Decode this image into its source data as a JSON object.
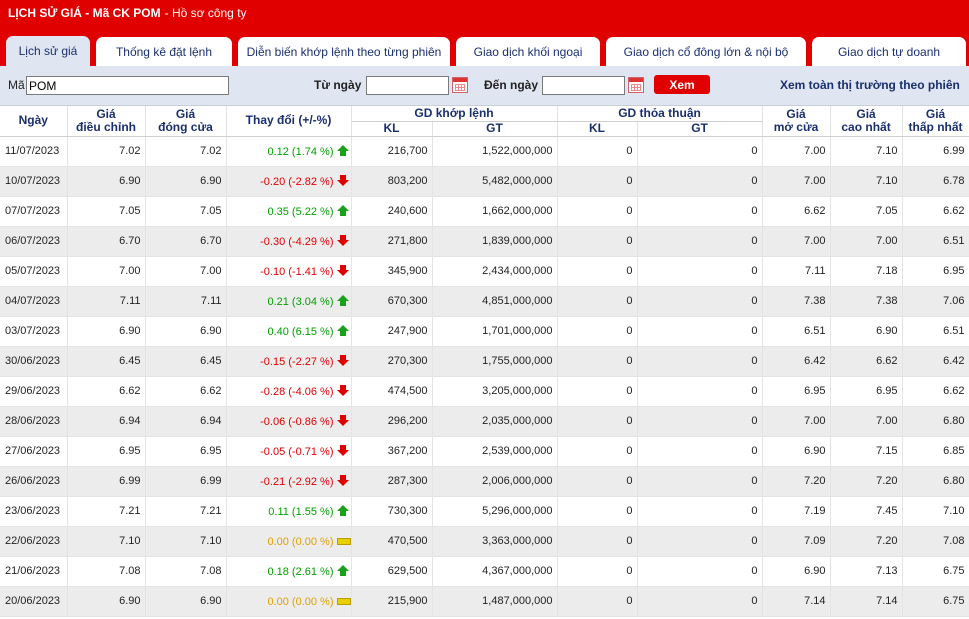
{
  "header": {
    "title": "LỊCH SỬ GIÁ - Mã CK POM",
    "subtitle": "- Hồ sơ công ty"
  },
  "tabs": [
    {
      "label": "Lịch sử giá"
    },
    {
      "label": "Thống kê đặt lệnh"
    },
    {
      "label": "Diễn biến khớp lệnh theo từng phiên"
    },
    {
      "label": "Giao dịch khối ngoại"
    },
    {
      "label": "Giao dịch cổ đông lớn & nội bộ"
    },
    {
      "label": "Giao dịch tự doanh"
    }
  ],
  "filter": {
    "symbol_label": "Mã",
    "symbol_value": "POM",
    "from_label": "Từ ngày",
    "from_value": "",
    "to_label": "Đến ngày",
    "to_value": "",
    "submit_label": "Xem",
    "view_all_label": "Xem toàn thị trường theo phiên"
  },
  "columns": {
    "date": "Ngày",
    "adj_price": "Giá điều chỉnh",
    "close_price": "Giá đóng cửa",
    "change": "Thay đổi (+/-%)",
    "matched_group": "GD khớp lệnh",
    "matched_kl": "KL",
    "matched_gt": "GT",
    "deal_group": "GD thỏa thuận",
    "deal_kl": "KL",
    "deal_gt": "GT",
    "open_price": "Giá mở cửa",
    "high_price": "Giá cao nhất",
    "low_price": "Giá thấp nhất"
  },
  "colors": {
    "up": "#00a000",
    "down": "#e00000",
    "flat": "#e0a000",
    "brand": "#e00000"
  },
  "rows": [
    {
      "date": "11/07/2023",
      "adj": "7.02",
      "close": "7.02",
      "change": "0.12 (1.74 %)",
      "dir": "up",
      "kl": "216,700",
      "gt": "1,522,000,000",
      "dkl": "0",
      "dgt": "0",
      "open": "7.00",
      "high": "7.10",
      "low": "6.99"
    },
    {
      "date": "10/07/2023",
      "adj": "6.90",
      "close": "6.90",
      "change": "-0.20 (-2.82 %)",
      "dir": "down",
      "kl": "803,200",
      "gt": "5,482,000,000",
      "dkl": "0",
      "dgt": "0",
      "open": "7.00",
      "high": "7.10",
      "low": "6.78"
    },
    {
      "date": "07/07/2023",
      "adj": "7.05",
      "close": "7.05",
      "change": "0.35 (5.22 %)",
      "dir": "up",
      "kl": "240,600",
      "gt": "1,662,000,000",
      "dkl": "0",
      "dgt": "0",
      "open": "6.62",
      "high": "7.05",
      "low": "6.62"
    },
    {
      "date": "06/07/2023",
      "adj": "6.70",
      "close": "6.70",
      "change": "-0.30 (-4.29 %)",
      "dir": "down",
      "kl": "271,800",
      "gt": "1,839,000,000",
      "dkl": "0",
      "dgt": "0",
      "open": "7.00",
      "high": "7.00",
      "low": "6.51"
    },
    {
      "date": "05/07/2023",
      "adj": "7.00",
      "close": "7.00",
      "change": "-0.10 (-1.41 %)",
      "dir": "down",
      "kl": "345,900",
      "gt": "2,434,000,000",
      "dkl": "0",
      "dgt": "0",
      "open": "7.11",
      "high": "7.18",
      "low": "6.95"
    },
    {
      "date": "04/07/2023",
      "adj": "7.11",
      "close": "7.11",
      "change": "0.21 (3.04 %)",
      "dir": "up",
      "kl": "670,300",
      "gt": "4,851,000,000",
      "dkl": "0",
      "dgt": "0",
      "open": "7.38",
      "high": "7.38",
      "low": "7.06"
    },
    {
      "date": "03/07/2023",
      "adj": "6.90",
      "close": "6.90",
      "change": "0.40 (6.15 %)",
      "dir": "up",
      "kl": "247,900",
      "gt": "1,701,000,000",
      "dkl": "0",
      "dgt": "0",
      "open": "6.51",
      "high": "6.90",
      "low": "6.51"
    },
    {
      "date": "30/06/2023",
      "adj": "6.45",
      "close": "6.45",
      "change": "-0.15 (-2.27 %)",
      "dir": "down",
      "kl": "270,300",
      "gt": "1,755,000,000",
      "dkl": "0",
      "dgt": "0",
      "open": "6.42",
      "high": "6.62",
      "low": "6.42"
    },
    {
      "date": "29/06/2023",
      "adj": "6.62",
      "close": "6.62",
      "change": "-0.28 (-4.06 %)",
      "dir": "down",
      "kl": "474,500",
      "gt": "3,205,000,000",
      "dkl": "0",
      "dgt": "0",
      "open": "6.95",
      "high": "6.95",
      "low": "6.62"
    },
    {
      "date": "28/06/2023",
      "adj": "6.94",
      "close": "6.94",
      "change": "-0.06 (-0.86 %)",
      "dir": "down",
      "kl": "296,200",
      "gt": "2,035,000,000",
      "dkl": "0",
      "dgt": "0",
      "open": "7.00",
      "high": "7.00",
      "low": "6.80"
    },
    {
      "date": "27/06/2023",
      "adj": "6.95",
      "close": "6.95",
      "change": "-0.05 (-0.71 %)",
      "dir": "down",
      "kl": "367,200",
      "gt": "2,539,000,000",
      "dkl": "0",
      "dgt": "0",
      "open": "6.90",
      "high": "7.15",
      "low": "6.85"
    },
    {
      "date": "26/06/2023",
      "adj": "6.99",
      "close": "6.99",
      "change": "-0.21 (-2.92 %)",
      "dir": "down",
      "kl": "287,300",
      "gt": "2,006,000,000",
      "dkl": "0",
      "dgt": "0",
      "open": "7.20",
      "high": "7.20",
      "low": "6.80"
    },
    {
      "date": "23/06/2023",
      "adj": "7.21",
      "close": "7.21",
      "change": "0.11 (1.55 %)",
      "dir": "up",
      "kl": "730,300",
      "gt": "5,296,000,000",
      "dkl": "0",
      "dgt": "0",
      "open": "7.19",
      "high": "7.45",
      "low": "7.10"
    },
    {
      "date": "22/06/2023",
      "adj": "7.10",
      "close": "7.10",
      "change": "0.00 (0.00 %)",
      "dir": "flat",
      "kl": "470,500",
      "gt": "3,363,000,000",
      "dkl": "0",
      "dgt": "0",
      "open": "7.09",
      "high": "7.20",
      "low": "7.08"
    },
    {
      "date": "21/06/2023",
      "adj": "7.08",
      "close": "7.08",
      "change": "0.18 (2.61 %)",
      "dir": "up",
      "kl": "629,500",
      "gt": "4,367,000,000",
      "dkl": "0",
      "dgt": "0",
      "open": "6.90",
      "high": "7.13",
      "low": "6.75"
    },
    {
      "date": "20/06/2023",
      "adj": "6.90",
      "close": "6.90",
      "change": "0.00 (0.00 %)",
      "dir": "flat",
      "kl": "215,900",
      "gt": "1,487,000,000",
      "dkl": "0",
      "dgt": "0",
      "open": "7.14",
      "high": "7.14",
      "low": "6.75"
    }
  ]
}
